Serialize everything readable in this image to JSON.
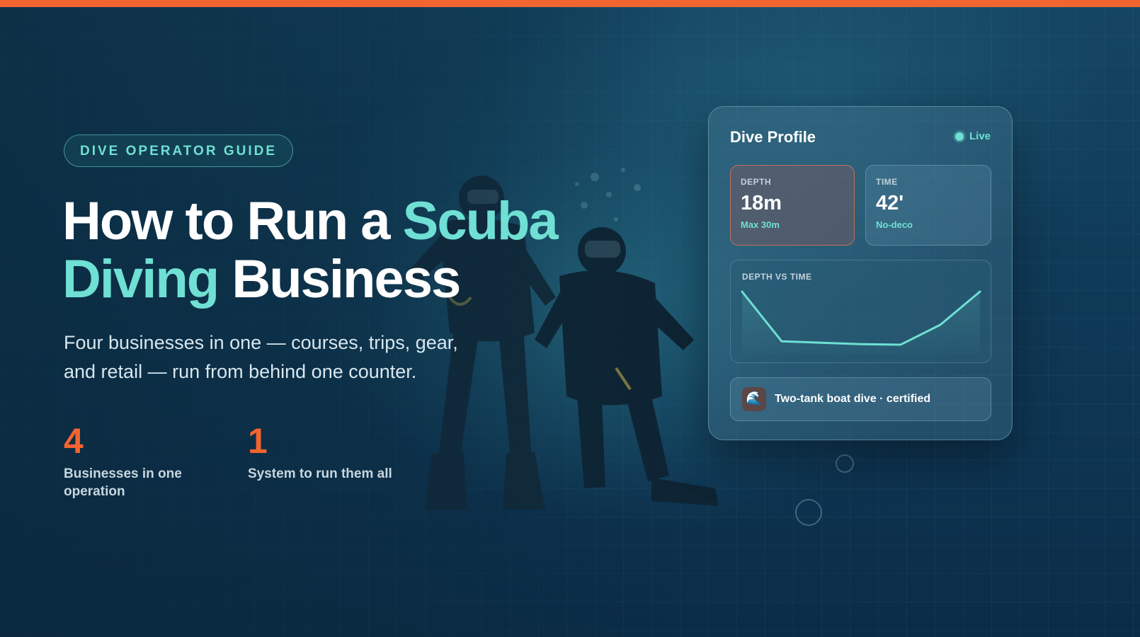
{
  "badge": "DIVE OPERATOR GUIDE",
  "headline": {
    "part1": "How to Run a ",
    "accent1": "Scuba",
    "accent2": "Diving",
    "part2": " Business"
  },
  "subtitle": "Four businesses in one — courses, trips, gear, and retail — run from behind one counter.",
  "stats": [
    {
      "number": "4",
      "label": "Businesses in one operation"
    },
    {
      "number": "1",
      "label": "System to run them all"
    }
  ],
  "card": {
    "title": "Dive Profile",
    "status": "Live",
    "metrics": [
      {
        "label": "DEPTH",
        "value": "18m",
        "sub": "Max 30m"
      },
      {
        "label": "TIME",
        "value": "42'",
        "sub": "No-deco"
      }
    ],
    "chart_label": "DEPTH VS TIME",
    "trip": {
      "icon": "wave-icon",
      "label": "Two-tank boat dive · certified"
    }
  },
  "chart_data": {
    "type": "line",
    "title": "DEPTH VS TIME",
    "xlabel": "",
    "ylabel": "",
    "x": [
      0,
      1,
      2,
      3,
      4,
      5,
      6
    ],
    "series": [
      {
        "values": [
          0,
          18,
          18.5,
          19,
          19.2,
          12,
          0
        ]
      }
    ],
    "y_inverted": true,
    "ylim": [
      0,
      21
    ],
    "grid": false,
    "legend": "none"
  },
  "colors": {
    "accent": "#f26430",
    "teal": "#6fe0d3",
    "background": "#0f3550"
  }
}
